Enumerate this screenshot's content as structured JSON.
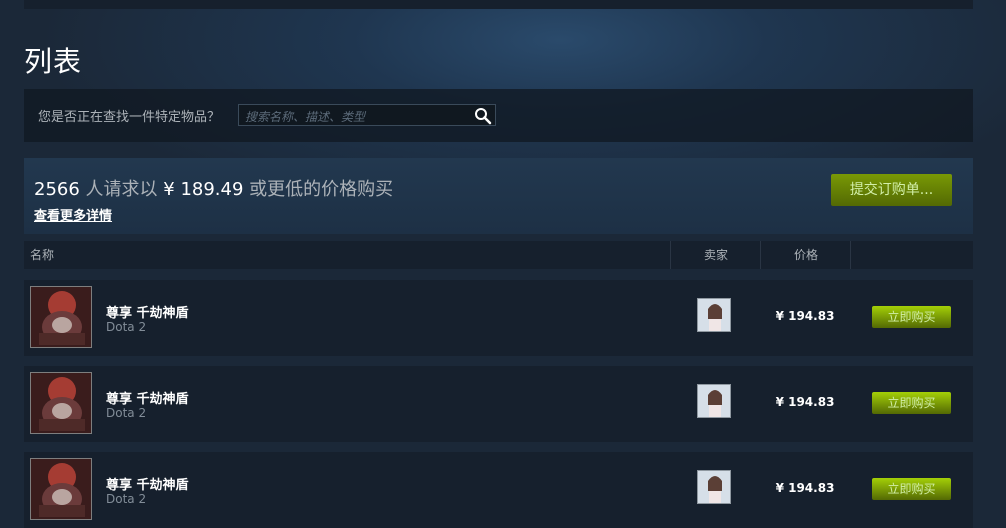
{
  "page": {
    "title": "列表"
  },
  "search": {
    "label": "您是否正在查找一件特定物品？",
    "placeholder": "搜索名称、描述、类型",
    "icon": "search-icon"
  },
  "buy_order": {
    "count": "2566",
    "text_mid": " 人请求以 ",
    "price": "¥ 189.49",
    "text_end": " 或更低的价格购买",
    "details_link": "查看更多详情",
    "button_label": "提交订购单..."
  },
  "table": {
    "headers": {
      "name": "名称",
      "seller": "卖家",
      "price": "价格"
    },
    "rows": [
      {
        "name": "尊享 千劫神盾",
        "game": "Dota 2",
        "price": "¥ 194.83",
        "button": "立即购买"
      },
      {
        "name": "尊享 千劫神盾",
        "game": "Dota 2",
        "price": "¥ 194.83",
        "button": "立即购买"
      },
      {
        "name": "尊享 千劫神盾",
        "game": "Dota 2",
        "price": "¥ 194.83",
        "button": "立即购买"
      }
    ]
  },
  "colors": {
    "background": "#1b2838",
    "accent_green": "#a4d007",
    "row_bg": "#16202d"
  }
}
